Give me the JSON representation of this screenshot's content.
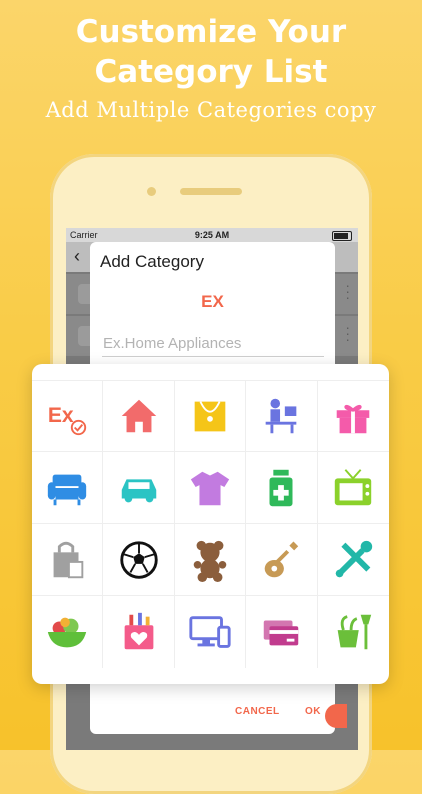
{
  "promo": {
    "headline_line1": "Customize Your",
    "headline_line2": "Category List",
    "subline": "Add Multiple Categories copy"
  },
  "status_bar": {
    "carrier": "Carrier",
    "time": "9:25 AM"
  },
  "dialog": {
    "title": "Add Category",
    "badge": "EX",
    "input_value": "",
    "input_placeholder": "Ex.Home Appliances",
    "cancel_label": "CANCEL",
    "ok_label": "OK"
  },
  "icons": [
    {
      "name": "ex-selected-icon",
      "color": "#F2674B",
      "selected": true
    },
    {
      "name": "home-icon",
      "color": "#F26B6B"
    },
    {
      "name": "jewelry-necklace-icon",
      "color": "#F5C518"
    },
    {
      "name": "work-desk-icon",
      "color": "#6A74E0"
    },
    {
      "name": "gift-icon",
      "color": "#F45BAA"
    },
    {
      "name": "armchair-icon",
      "color": "#2F8DE4"
    },
    {
      "name": "car-icon",
      "color": "#2BC4C4"
    },
    {
      "name": "tshirt-icon",
      "color": "#C27BE0"
    },
    {
      "name": "medicine-bottle-icon",
      "color": "#2FB95A"
    },
    {
      "name": "tv-icon",
      "color": "#8BD12B"
    },
    {
      "name": "shopping-bag-icon",
      "color": "#A0A0A0"
    },
    {
      "name": "soccer-ball-icon",
      "color": "#111111"
    },
    {
      "name": "teddy-bear-icon",
      "color": "#8B5E3C"
    },
    {
      "name": "guitar-icon",
      "color": "#C79A55"
    },
    {
      "name": "tools-icon",
      "color": "#22B7A8"
    },
    {
      "name": "fruit-bowl-icon",
      "color": "#5FBF3A"
    },
    {
      "name": "love-gift-box-icon",
      "color": "#F45B8A"
    },
    {
      "name": "computer-devices-icon",
      "color": "#6A74E0"
    },
    {
      "name": "credit-cards-icon",
      "color": "#C13C8E"
    },
    {
      "name": "gardening-icon",
      "color": "#6BBF3A"
    }
  ]
}
